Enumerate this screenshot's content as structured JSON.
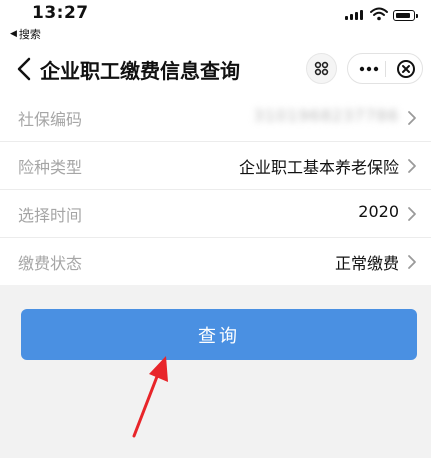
{
  "status_bar": {
    "time": "13:27",
    "back_app_label": "搜索",
    "back_app_icon": "triangle-left-icon"
  },
  "nav": {
    "title": "企业职工缴费信息查询",
    "back_icon": "chevron-left-icon",
    "scan_icon": "scan-icon",
    "more_icon": "more-dots-icon",
    "close_icon": "close-circle-icon"
  },
  "form": {
    "rows": [
      {
        "label": "社保编码",
        "value": "3101968237786"
      },
      {
        "label": "险种类型",
        "value": "企业职工基本养老保险"
      },
      {
        "label": "选择时间",
        "value": "2020"
      },
      {
        "label": "缴费状态",
        "value": "正常缴费"
      }
    ]
  },
  "query_button": {
    "label": "查询",
    "color": "#4a90e2"
  },
  "annotation": {
    "arrow_color": "#e8252a"
  }
}
